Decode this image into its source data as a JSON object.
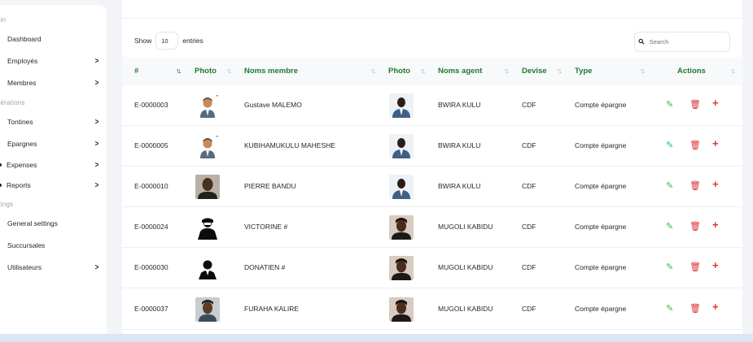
{
  "sidebar": {
    "sections": {
      "main": "ain",
      "operations": "pérations",
      "settings": "ttings"
    },
    "items": [
      {
        "label": "Dashboard"
      },
      {
        "label": "Employés"
      },
      {
        "label": "Membres"
      },
      {
        "label": "Tontines"
      },
      {
        "label": "Epargnes"
      },
      {
        "label": "Expenses"
      },
      {
        "label": "Reports"
      },
      {
        "label": "General settings"
      },
      {
        "label": "Succursales"
      },
      {
        "label": "Utilisateurs"
      }
    ],
    "chevron": ">"
  },
  "table_controls": {
    "show_label": "Show",
    "page_length": "10",
    "entries_label": "entries",
    "search_placeholder": "Search"
  },
  "columns": [
    "#",
    "Photo",
    "Noms membre",
    "Photo",
    "Noms agent",
    "Devise",
    "Type",
    "Actions"
  ],
  "rows": [
    {
      "id": "E-0000003",
      "member": "Gustave MALEMO",
      "agent": "BWIRA KULU",
      "devise": "CDF",
      "type": "Compte épargne"
    },
    {
      "id": "E-0000005",
      "member": "KUBIHAMUKULU MAHESHE",
      "agent": "BWIRA KULU",
      "devise": "CDF",
      "type": "Compte épargne"
    },
    {
      "id": "E-0000010",
      "member": "PIERRE BANDU",
      "agent": "BWIRA KULU",
      "devise": "CDF",
      "type": "Compte épargne"
    },
    {
      "id": "E-0000024",
      "member": "VICTORINE #",
      "agent": "MUGOLI KABIDU",
      "devise": "CDF",
      "type": "Compte épargne"
    },
    {
      "id": "E-0000030",
      "member": "DONATIEN #",
      "agent": "MUGOLI KABIDU",
      "devise": "CDF",
      "type": "Compte épargne"
    },
    {
      "id": "E-0000037",
      "member": "FURAHA KALIRE",
      "agent": "MUGOLI KABIDU",
      "devise": "CDF",
      "type": "Compte épargne"
    }
  ],
  "icons": {
    "edit": "edit-icon",
    "delete": "trash-icon",
    "add": "plus-icon",
    "sort": "sort-icon"
  },
  "colors": {
    "header_text": "#1f7a2d",
    "edit": "#2fbf56",
    "danger": "#e03131"
  }
}
